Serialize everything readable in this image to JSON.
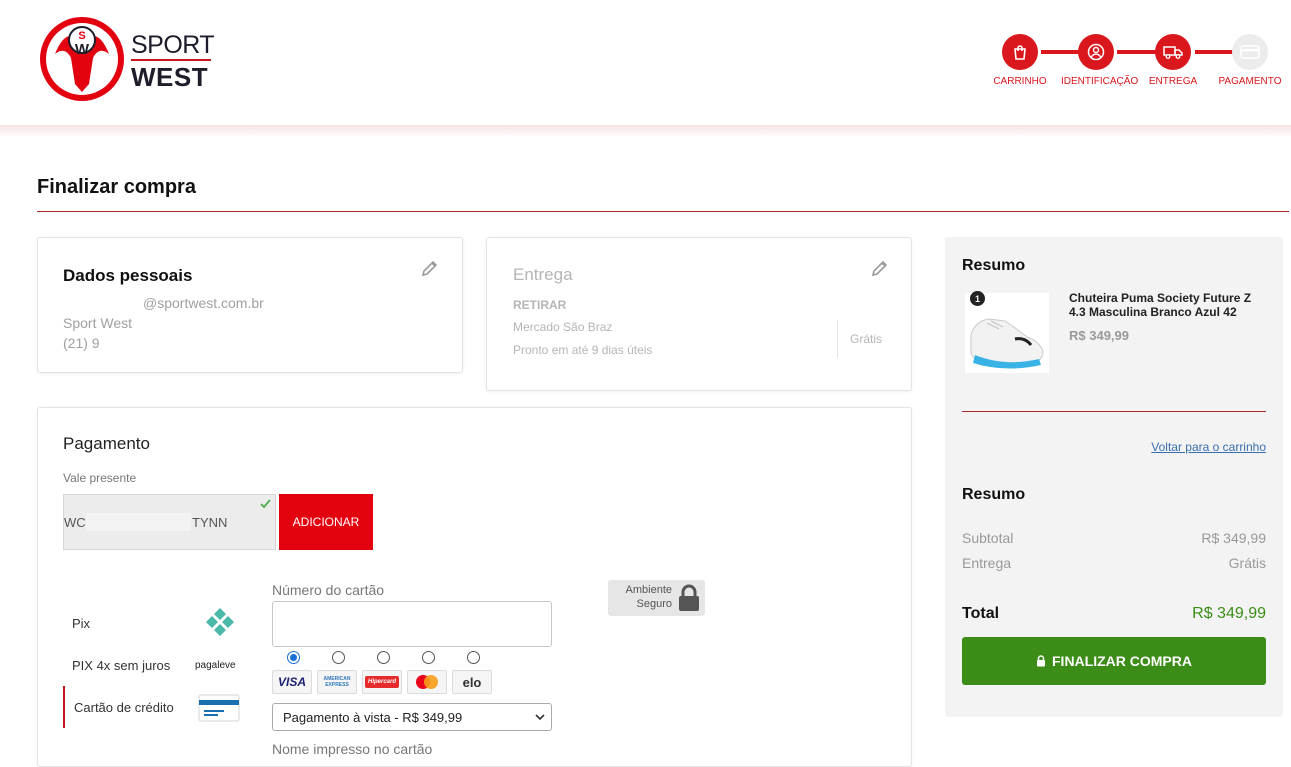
{
  "logo": {
    "line1": "SPORT",
    "line2": "WEST"
  },
  "steps": [
    {
      "label": "CARRINHO",
      "icon": "shopping-bag-icon",
      "active": true
    },
    {
      "label": "IDENTIFICAÇÃO",
      "icon": "user-icon",
      "active": true
    },
    {
      "label": "ENTREGA",
      "icon": "truck-icon",
      "active": true
    },
    {
      "label": "PAGAMENTO",
      "icon": "credit-card-icon",
      "active": false
    }
  ],
  "page": {
    "title": "Finalizar compra"
  },
  "dados": {
    "title": "Dados pessoais",
    "email": "@sportwest.com.br",
    "name": "Sport West",
    "phone": "(21) 9"
  },
  "entrega": {
    "title": "Entrega",
    "type": "RETIRAR",
    "place": "Mercado São Braz",
    "eta": "Pronto em até 9 dias úteis",
    "price": "Grátis"
  },
  "pagamento": {
    "title": "Pagamento",
    "voucher_label": "Vale presente",
    "voucher_value_start": "WC",
    "voucher_value_end": "TYNN",
    "add_label": "ADICIONAR",
    "methods": [
      {
        "label": "Pix",
        "icon": "pix-icon"
      },
      {
        "label": "PIX 4x sem juros",
        "icon": "pagaleve-logo",
        "logo_text": "pagaleve"
      },
      {
        "label": "Cartão de crédito",
        "icon": "credit-card-icon"
      }
    ],
    "card_number_label": "Número do cartão",
    "card_number_value": "",
    "brands": [
      "VISA",
      "AMERICAN EXPRESS",
      "Hipercard",
      "Mastercard",
      "elo"
    ],
    "installments_selected": "Pagamento à vista - R$ 349,99",
    "name_label": "Nome impresso no cartão",
    "secure_line1": "Ambiente",
    "secure_line2": "Seguro"
  },
  "summary": {
    "title": "Resumo",
    "item": {
      "qty": "1",
      "name": "Chuteira Puma Society Future Z 4.3 Masculina Branco Azul 42",
      "price": "R$ 349,99"
    },
    "back_link": "Voltar para o carrinho",
    "totals_title": "Resumo",
    "subtotal_label": "Subtotal",
    "subtotal_value": "R$ 349,99",
    "shipping_label": "Entrega",
    "shipping_value": "Grátis",
    "total_label": "Total",
    "total_value": "R$ 349,99",
    "finalize_label": "FINALIZAR COMPRA"
  },
  "colors": {
    "brand_red": "#d9171c",
    "green": "#3b8d17"
  }
}
